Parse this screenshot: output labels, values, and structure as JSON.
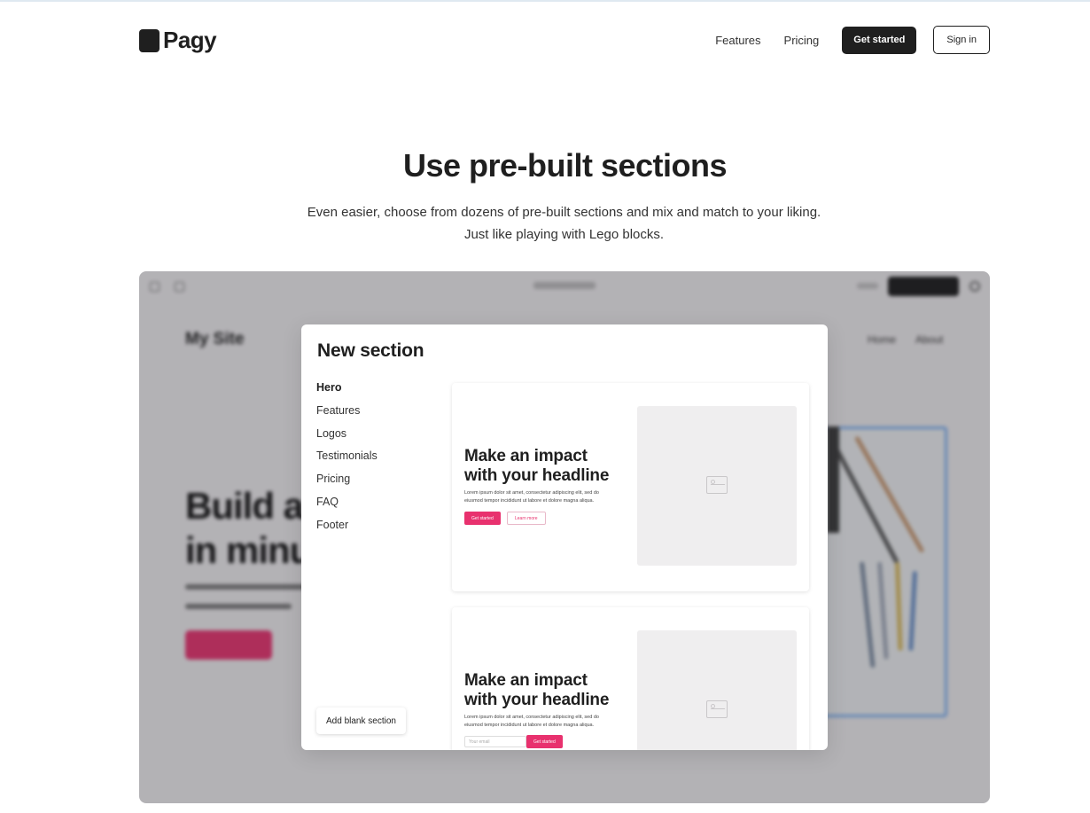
{
  "nav": {
    "logo_text": "Pagy",
    "links": [
      "Features",
      "Pricing"
    ],
    "get_started": "Get started",
    "sign_in": "Sign in"
  },
  "hero": {
    "title": "Use pre-built sections",
    "subtitle_line1": "Even easier, choose from dozens of pre-built sections and mix and match to your liking.",
    "subtitle_line2": "Just like playing with Lego blocks."
  },
  "demo": {
    "site_name": "My Site",
    "site_menu": [
      "Home",
      "About"
    ],
    "hero_text": "Build a\nin minu",
    "modal": {
      "title": "New section",
      "categories": [
        "Hero",
        "Features",
        "Logos",
        "Testimonials",
        "Pricing",
        "FAQ",
        "Footer"
      ],
      "active_category": "Hero",
      "add_blank": "Add blank section",
      "cards": [
        {
          "headline": "Make an impact with your headline",
          "body": "Lorem ipsum dolor sit amet, consectetur adipiscing elit, sed do eiusmod tempor incididunt ut labore et dolore magna aliqua.",
          "primary": "Get started",
          "secondary": "Learn more"
        },
        {
          "headline": "Make an impact with your headline",
          "body": "Lorem ipsum dolor sit amet, consectetur adipiscing elit, sed do eiusmod tempor incididunt ut labore et dolore magna aliqua.",
          "input_placeholder": "Your email",
          "primary": "Get started"
        }
      ]
    }
  },
  "colors": {
    "accent": "#e8316e",
    "dark": "#1f1f1f"
  }
}
